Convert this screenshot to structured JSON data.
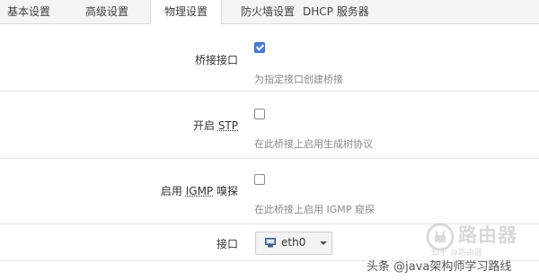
{
  "tabs": [
    {
      "label": "基本设置",
      "active": false
    },
    {
      "label": "高级设置",
      "active": false
    },
    {
      "label": "物理设置",
      "active": true
    },
    {
      "label": "防火墙设置",
      "active": false
    },
    {
      "label": "DHCP 服务器",
      "active": false
    }
  ],
  "settings": {
    "bridge": {
      "label": "桥接接口",
      "checked": true,
      "description": "为指定接口创建桥接"
    },
    "stp": {
      "label_prefix": "开启 ",
      "label_abbr": "STP",
      "checked": false,
      "description": "在此桥接上启用生成树协议"
    },
    "igmp": {
      "label_prefix": "启用 ",
      "label_abbr": "IGMP",
      "label_suffix": " 嗅探",
      "checked": false,
      "description": "在此桥接上启用 IGMP 窥探"
    },
    "interface": {
      "label": "接口",
      "selected_value": "eth0",
      "icon": "network-port-icon"
    }
  },
  "logo": {
    "title": "路由器",
    "subtitle": "知乎 @路由器"
  },
  "watermark": "头条 @java架构师学习路线",
  "colors": {
    "checkbox_checked": "#4a7fd0",
    "tab_bar_bg": "#f4f4f4",
    "description_text": "#888888"
  }
}
